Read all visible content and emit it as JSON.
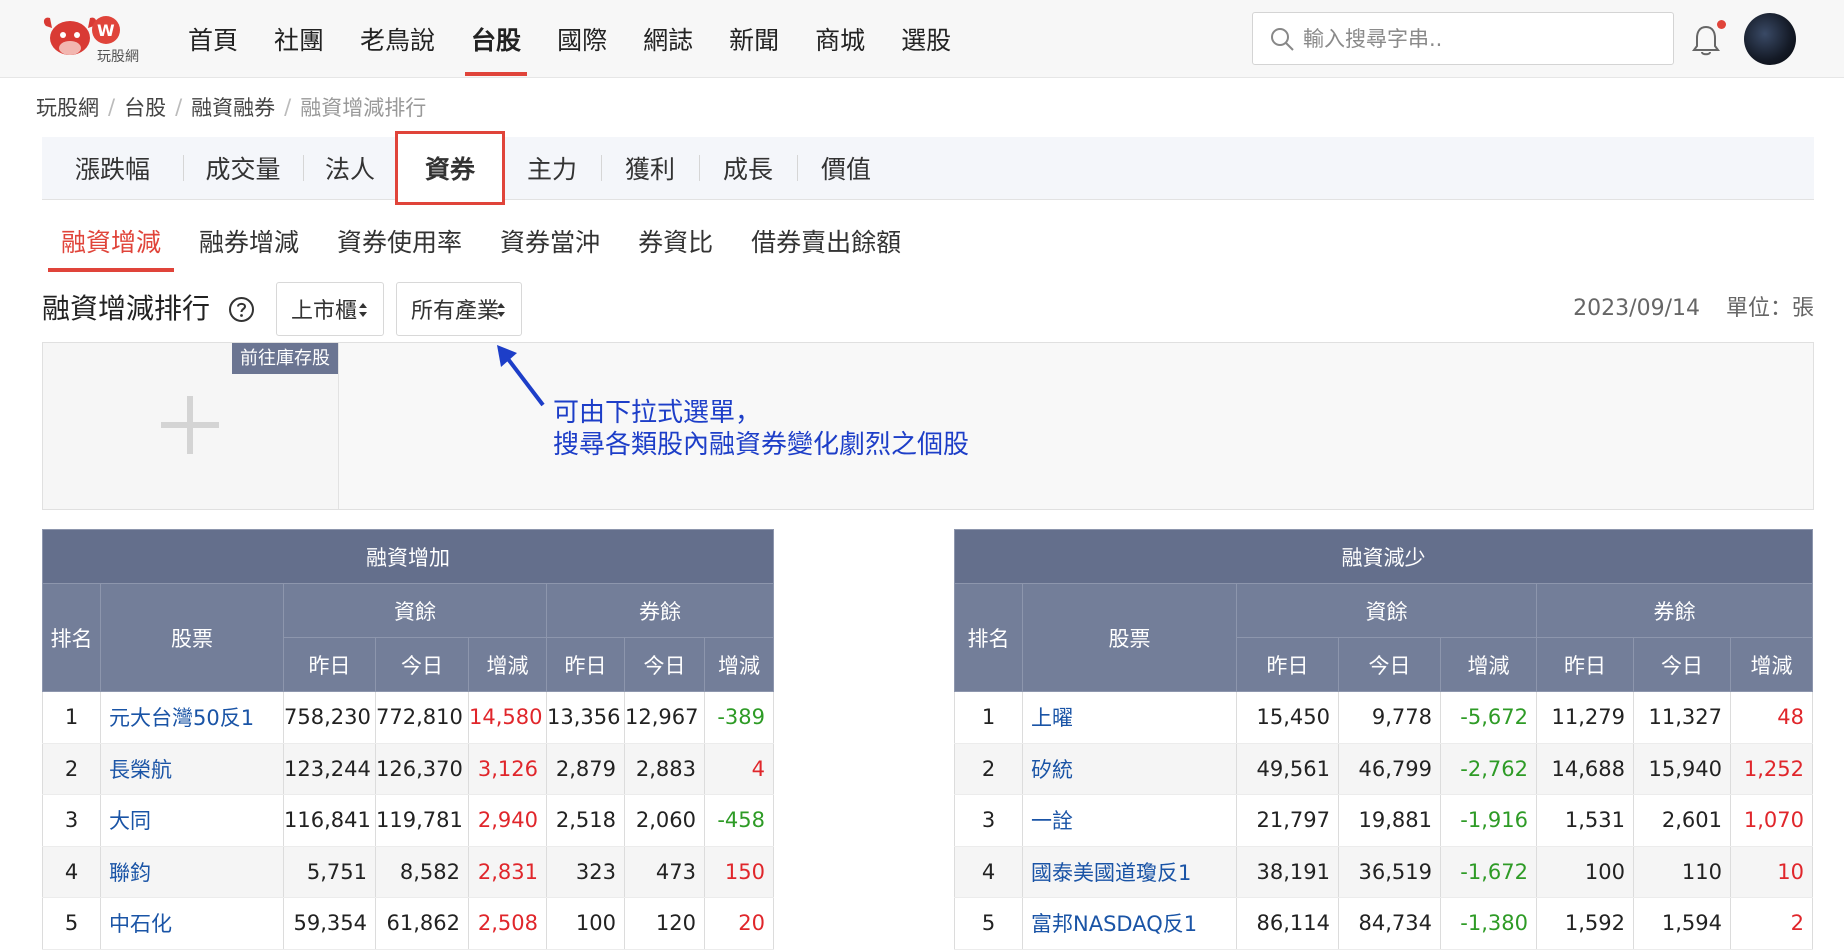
{
  "header": {
    "logo_text": "玩股網",
    "nav": [
      "首頁",
      "社團",
      "老鳥說",
      "台股",
      "國際",
      "網誌",
      "新聞",
      "商城",
      "選股"
    ],
    "nav_active_index": 3,
    "search_placeholder": "輸入搜尋字串..",
    "accent_color": "#e0443a"
  },
  "breadcrumb": [
    "玩股網",
    "台股",
    "融資融券",
    "融資增減排行"
  ],
  "category_tabs": [
    "漲跌幅",
    "成交量",
    "法人",
    "資券",
    "主力",
    "獲利",
    "成長",
    "價值"
  ],
  "category_active_index": 3,
  "sub_tabs": [
    "融資增減",
    "融券增減",
    "資券使用率",
    "資券當沖",
    "券資比",
    "借券賣出餘額"
  ],
  "sub_active_index": 0,
  "title": "融資增減排行",
  "filters": {
    "market": "上市櫃",
    "industry": "所有產業"
  },
  "date": "2023/09/14",
  "unit": "單位：張",
  "banner": {
    "goto_label": "前往庫存股",
    "annotation_line1": "可由下拉式選單，",
    "annotation_line2": "搜尋各類股內融資券變化劇烈之個股"
  },
  "table_headers": {
    "rank": "排名",
    "stock": "股票",
    "margin": "資餘",
    "short": "券餘",
    "yesterday": "昨日",
    "today": "今日",
    "change": "增減"
  },
  "increase": {
    "title": "融資增加",
    "rows": [
      {
        "rank": "1",
        "stock": "元大台灣50反1",
        "m_y": "758,230",
        "m_t": "772,810",
        "m_c": "14,580",
        "s_y": "13,356",
        "s_t": "12,967",
        "s_c": "-389"
      },
      {
        "rank": "2",
        "stock": "長榮航",
        "m_y": "123,244",
        "m_t": "126,370",
        "m_c": "3,126",
        "s_y": "2,879",
        "s_t": "2,883",
        "s_c": "4"
      },
      {
        "rank": "3",
        "stock": "大同",
        "m_y": "116,841",
        "m_t": "119,781",
        "m_c": "2,940",
        "s_y": "2,518",
        "s_t": "2,060",
        "s_c": "-458"
      },
      {
        "rank": "4",
        "stock": "聯鈞",
        "m_y": "5,751",
        "m_t": "8,582",
        "m_c": "2,831",
        "s_y": "323",
        "s_t": "473",
        "s_c": "150"
      },
      {
        "rank": "5",
        "stock": "中石化",
        "m_y": "59,354",
        "m_t": "61,862",
        "m_c": "2,508",
        "s_y": "100",
        "s_t": "120",
        "s_c": "20"
      }
    ]
  },
  "decrease": {
    "title": "融資減少",
    "rows": [
      {
        "rank": "1",
        "stock": "上曜",
        "m_y": "15,450",
        "m_t": "9,778",
        "m_c": "-5,672",
        "s_y": "11,279",
        "s_t": "11,327",
        "s_c": "48"
      },
      {
        "rank": "2",
        "stock": "矽統",
        "m_y": "49,561",
        "m_t": "46,799",
        "m_c": "-2,762",
        "s_y": "14,688",
        "s_t": "15,940",
        "s_c": "1,252"
      },
      {
        "rank": "3",
        "stock": "一詮",
        "m_y": "21,797",
        "m_t": "19,881",
        "m_c": "-1,916",
        "s_y": "1,531",
        "s_t": "2,601",
        "s_c": "1,070"
      },
      {
        "rank": "4",
        "stock": "國泰美國道瓊反1",
        "m_y": "38,191",
        "m_t": "36,519",
        "m_c": "-1,672",
        "s_y": "100",
        "s_t": "110",
        "s_c": "10"
      },
      {
        "rank": "5",
        "stock": "富邦NASDAQ反1",
        "m_y": "86,114",
        "m_t": "84,734",
        "m_c": "-1,380",
        "s_y": "1,592",
        "s_t": "1,594",
        "s_c": "2"
      }
    ]
  }
}
